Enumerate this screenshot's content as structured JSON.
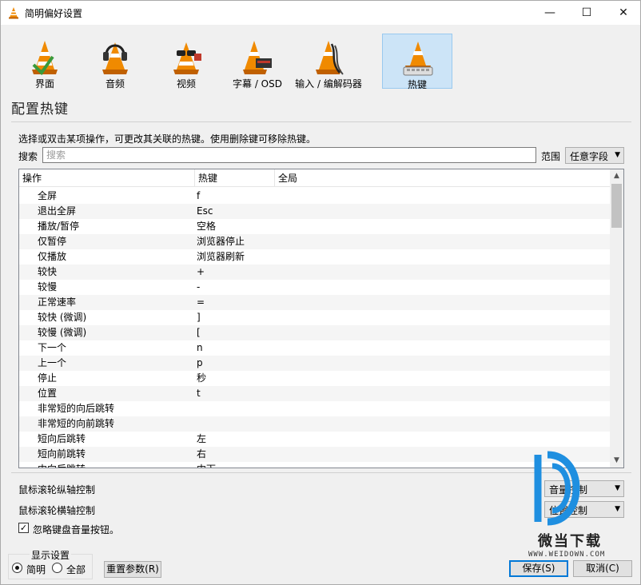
{
  "window": {
    "title": "简明偏好设置",
    "controls": {
      "minimize": "—",
      "maximize": "☐",
      "close": "✕"
    }
  },
  "categories": [
    {
      "label": "界面",
      "icon": "cone-interface-icon",
      "active": false
    },
    {
      "label": "音频",
      "icon": "cone-headphones-icon",
      "active": false
    },
    {
      "label": "视频",
      "icon": "cone-glasses-icon",
      "active": false
    },
    {
      "label": "字幕 / OSD",
      "icon": "cone-subtitle-icon",
      "active": false
    },
    {
      "label": "输入 / 编解码器",
      "icon": "cone-cables-icon",
      "active": false
    },
    {
      "label": "热键",
      "icon": "cone-hotkeys-icon",
      "active": true
    }
  ],
  "section_title": "配置热键",
  "description": "选择或双击某项操作，可更改其关联的热键。使用删除键可移除热键。",
  "search": {
    "label": "搜索",
    "placeholder": "搜索",
    "value": ""
  },
  "scope": {
    "label": "范围",
    "value": "任意字段"
  },
  "table": {
    "columns": [
      "操作",
      "热键",
      "全局"
    ],
    "rows": [
      {
        "action": "全屏",
        "hotkey": "f"
      },
      {
        "action": "退出全屏",
        "hotkey": "Esc"
      },
      {
        "action": "播放/暂停",
        "hotkey": "空格"
      },
      {
        "action": "仅暂停",
        "hotkey": "浏览器停止"
      },
      {
        "action": "仅播放",
        "hotkey": "浏览器刷新"
      },
      {
        "action": "较快",
        "hotkey": "+"
      },
      {
        "action": "较慢",
        "hotkey": "-"
      },
      {
        "action": "正常速率",
        "hotkey": "="
      },
      {
        "action": "较快 (微调)",
        "hotkey": "]"
      },
      {
        "action": "较慢 (微调)",
        "hotkey": "["
      },
      {
        "action": "下一个",
        "hotkey": "n"
      },
      {
        "action": "上一个",
        "hotkey": "p"
      },
      {
        "action": "停止",
        "hotkey": "秒"
      },
      {
        "action": "位置",
        "hotkey": "t"
      },
      {
        "action": "非常短的向后跳转",
        "hotkey": ""
      },
      {
        "action": "非常短的向前跳转",
        "hotkey": ""
      },
      {
        "action": "短向后跳转",
        "hotkey": "左"
      },
      {
        "action": "短向前跳转",
        "hotkey": "右"
      },
      {
        "action": "中向后跳转",
        "hotkey": "中下"
      }
    ]
  },
  "mouse_wheel_vertical": {
    "label": "鼠标滚轮纵轴控制",
    "value": "音量控制"
  },
  "mouse_wheel_horizontal": {
    "label": "鼠标滚轮横轴控制",
    "value": "位置控制"
  },
  "ignore_volume_keys": {
    "label": "忽略键盘音量按钮。",
    "checked": true
  },
  "display_settings": {
    "title": "显示设置",
    "options": [
      {
        "label": "简明",
        "selected": true
      },
      {
        "label": "全部",
        "selected": false
      }
    ]
  },
  "buttons": {
    "reset": "重置参数(R)",
    "save": "保存(S)",
    "cancel": "取消(C)"
  },
  "watermark": {
    "brand": "微当下载",
    "url": "WWW.WEIDOWN.COM"
  },
  "colors": {
    "cone_orange": "#f08a00",
    "active_tab": "#cce4f7",
    "watermark_blue": "#1f8fe0"
  }
}
